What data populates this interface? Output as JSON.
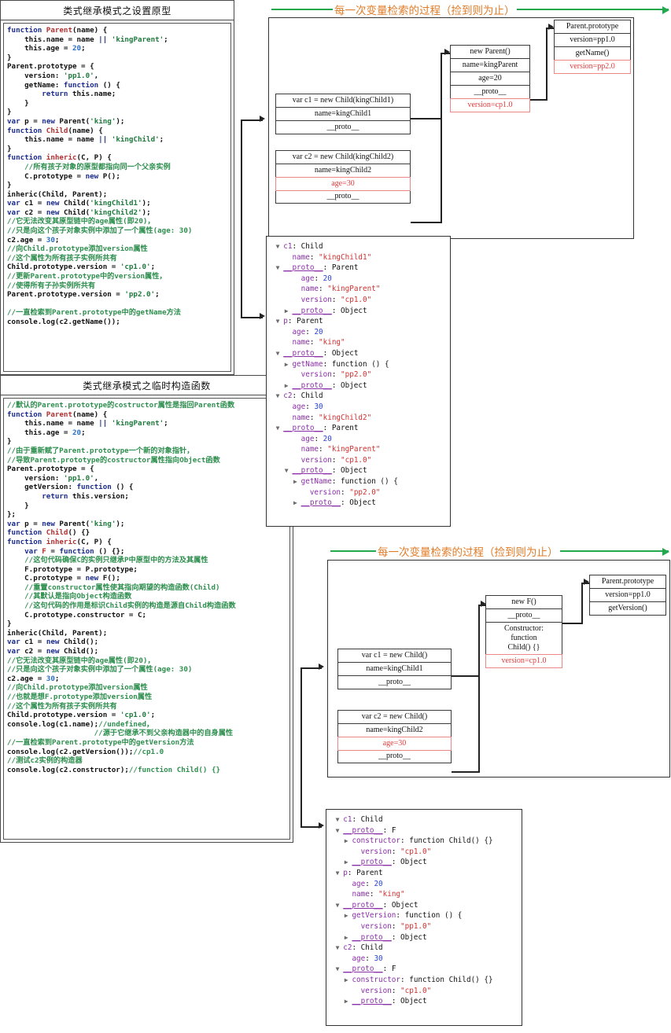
{
  "section1": {
    "code_title": "类式继承模式之设置原型",
    "banner": "每一次变量检索的过程（捡到则为止）",
    "code_lines": [
      [
        [
          "kw",
          "function "
        ],
        [
          "fn",
          "Parent"
        ],
        [
          "pl",
          "(name) {"
        ]
      ],
      [
        [
          "pl",
          "    this.name = name "
        ],
        [
          "kw",
          "|| "
        ],
        [
          "str",
          "'kingParent'"
        ],
        [
          "pl",
          ";"
        ]
      ],
      [
        [
          "pl",
          "    this.age = "
        ],
        [
          "num",
          "20"
        ],
        [
          "pl",
          ";"
        ]
      ],
      [
        [
          "pl",
          "}"
        ]
      ],
      [
        [
          "pl",
          "Parent.prototype = {"
        ]
      ],
      [
        [
          "pl",
          "    version: "
        ],
        [
          "str",
          "'pp1.0'"
        ],
        [
          "pl",
          ","
        ]
      ],
      [
        [
          "pl",
          "    getName: "
        ],
        [
          "kw",
          "function"
        ],
        [
          "pl",
          " () {"
        ]
      ],
      [
        [
          "kw",
          "        return "
        ],
        [
          "pl",
          "this.name;"
        ]
      ],
      [
        [
          "pl",
          "    }"
        ]
      ],
      [
        [
          "pl",
          "}"
        ]
      ],
      [
        [
          "kw",
          "var "
        ],
        [
          "pl",
          "p = "
        ],
        [
          "kw",
          "new "
        ],
        [
          "pl",
          "Parent("
        ],
        [
          "str",
          "'king'"
        ],
        [
          "pl",
          ");"
        ]
      ],
      [
        [
          "kw",
          "function "
        ],
        [
          "fn",
          "Child"
        ],
        [
          "pl",
          "(name) {"
        ]
      ],
      [
        [
          "pl",
          "    this.name = name "
        ],
        [
          "kw",
          "|| "
        ],
        [
          "str",
          "'kingChild'"
        ],
        [
          "pl",
          ";"
        ]
      ],
      [
        [
          "pl",
          "}"
        ]
      ],
      [
        [
          "kw",
          "function "
        ],
        [
          "fn",
          "inheric"
        ],
        [
          "pl",
          "(C, P) {"
        ]
      ],
      [
        [
          "cmt",
          "    //所有孩子对象的原型都指向同一个父亲实例"
        ]
      ],
      [
        [
          "pl",
          "    C.prototype = "
        ],
        [
          "kw",
          "new "
        ],
        [
          "pl",
          "P();"
        ]
      ],
      [
        [
          "pl",
          "}"
        ]
      ],
      [
        [
          "pl",
          "inheric(Child, Parent);"
        ]
      ],
      [
        [
          "kw",
          "var "
        ],
        [
          "pl",
          "c1 = "
        ],
        [
          "kw",
          "new "
        ],
        [
          "pl",
          "Child("
        ],
        [
          "str",
          "'kingChild1'"
        ],
        [
          "pl",
          ");"
        ]
      ],
      [
        [
          "kw",
          "var "
        ],
        [
          "pl",
          "c2 = "
        ],
        [
          "kw",
          "new "
        ],
        [
          "pl",
          "Child("
        ],
        [
          "str",
          "'kingChild2'"
        ],
        [
          "pl",
          ");"
        ]
      ],
      [
        [
          "cmt",
          "//它无法改变其原型链中的age属性(即20)，"
        ]
      ],
      [
        [
          "cmt",
          "//只是向这个孩子对象实例中添加了一个属性(age: 30)"
        ]
      ],
      [
        [
          "pl",
          "c2.age = "
        ],
        [
          "num",
          "30"
        ],
        [
          "pl",
          ";"
        ]
      ],
      [
        [
          "cmt",
          "//向Child.prototype添加version属性"
        ]
      ],
      [
        [
          "cmt",
          "//这个属性为所有孩子实例所共有"
        ]
      ],
      [
        [
          "pl",
          "Child.prototype.version = "
        ],
        [
          "str",
          "'cp1.0'"
        ],
        [
          "pl",
          ";"
        ]
      ],
      [
        [
          "cmt",
          "//更新Parent.prototype中的version属性，"
        ]
      ],
      [
        [
          "cmt",
          "//使得所有子孙实例所共有"
        ]
      ],
      [
        [
          "pl",
          "Parent.prototype.version = "
        ],
        [
          "str",
          "'pp2.0'"
        ],
        [
          "pl",
          ";"
        ]
      ],
      [
        [
          "pl",
          ""
        ]
      ],
      [
        [
          "cmt",
          "//一直检索到Parent.prototype中的getName方法"
        ]
      ],
      [
        [
          "pl",
          "console.log(c2.getName());"
        ]
      ]
    ],
    "boxes": {
      "c1": [
        "var c1 = new Child(kingChild1)",
        "name=kingChild1",
        "__proto__"
      ],
      "c2": [
        "var c2 = new Child(kingChild2)",
        "name=kingChild2",
        "age=30",
        "__proto__"
      ],
      "parent_inst": [
        "new Parent()",
        "name=kingParent",
        "age=20",
        "__proto__",
        "version=cp1.0"
      ],
      "parent_proto": [
        "Parent.prototype",
        "version=pp1.0",
        "getName()",
        "version=pp2.0"
      ]
    },
    "console_lines": [
      {
        "indent": 0,
        "tri": "▼",
        "key": "c1",
        "sep": ": ",
        "val": "Child",
        "vtype": "plain"
      },
      {
        "indent": 1,
        "tri": "",
        "key": "name",
        "sep": ": ",
        "val": "\"kingChild1\"",
        "vtype": "str"
      },
      {
        "indent": 0,
        "tri": "▼",
        "key": "__proto__",
        "sep": ": ",
        "val": "Parent",
        "vtype": "plain",
        "proto": true
      },
      {
        "indent": 2,
        "tri": "",
        "key": "age",
        "sep": ": ",
        "val": "20",
        "vtype": "num"
      },
      {
        "indent": 2,
        "tri": "",
        "key": "name",
        "sep": ": ",
        "val": "\"kingParent\"",
        "vtype": "str"
      },
      {
        "indent": 2,
        "tri": "",
        "key": "version",
        "sep": ": ",
        "val": "\"cp1.0\"",
        "vtype": "str"
      },
      {
        "indent": 1,
        "tri": "▶",
        "key": "__proto__",
        "sep": ": ",
        "val": "Object",
        "vtype": "plain",
        "proto": true
      },
      {
        "indent": 0,
        "tri": "▼",
        "key": "p",
        "sep": ": ",
        "val": "Parent",
        "vtype": "plain"
      },
      {
        "indent": 1,
        "tri": "",
        "key": "age",
        "sep": ": ",
        "val": "20",
        "vtype": "num"
      },
      {
        "indent": 1,
        "tri": "",
        "key": "name",
        "sep": ": ",
        "val": "\"king\"",
        "vtype": "str"
      },
      {
        "indent": 0,
        "tri": "▼",
        "key": "__proto__",
        "sep": ": ",
        "val": "Object",
        "vtype": "plain",
        "proto": true
      },
      {
        "indent": 1,
        "tri": "▶",
        "key": "getName",
        "sep": ": ",
        "val": "function () {",
        "vtype": "plain"
      },
      {
        "indent": 2,
        "tri": "",
        "key": "version",
        "sep": ": ",
        "val": "\"pp2.0\"",
        "vtype": "str"
      },
      {
        "indent": 1,
        "tri": "▶",
        "key": "__proto__",
        "sep": ": ",
        "val": "Object",
        "vtype": "plain",
        "proto": true
      },
      {
        "indent": 0,
        "tri": "▼",
        "key": "c2",
        "sep": ": ",
        "val": "Child",
        "vtype": "plain"
      },
      {
        "indent": 1,
        "tri": "",
        "key": "age",
        "sep": ": ",
        "val": "30",
        "vtype": "num"
      },
      {
        "indent": 1,
        "tri": "",
        "key": "name",
        "sep": ": ",
        "val": "\"kingChild2\"",
        "vtype": "str"
      },
      {
        "indent": 0,
        "tri": "▼",
        "key": "__proto__",
        "sep": ": ",
        "val": "Parent",
        "vtype": "plain",
        "proto": true
      },
      {
        "indent": 2,
        "tri": "",
        "key": "age",
        "sep": ": ",
        "val": "20",
        "vtype": "num"
      },
      {
        "indent": 2,
        "tri": "",
        "key": "name",
        "sep": ": ",
        "val": "\"kingParent\"",
        "vtype": "str"
      },
      {
        "indent": 2,
        "tri": "",
        "key": "version",
        "sep": ": ",
        "val": "\"cp1.0\"",
        "vtype": "str"
      },
      {
        "indent": 1,
        "tri": "▼",
        "key": "__proto__",
        "sep": ": ",
        "val": "Object",
        "vtype": "plain",
        "proto": true
      },
      {
        "indent": 2,
        "tri": "▶",
        "key": "getName",
        "sep": ": ",
        "val": "function () {",
        "vtype": "plain"
      },
      {
        "indent": 3,
        "tri": "",
        "key": "version",
        "sep": ": ",
        "val": "\"pp2.0\"",
        "vtype": "str"
      },
      {
        "indent": 2,
        "tri": "▶",
        "key": "__proto__",
        "sep": ": ",
        "val": "Object",
        "vtype": "plain",
        "proto": true
      }
    ]
  },
  "section2": {
    "code_title": "类式继承模式之临时构造函数",
    "banner": "每一次变量检索的过程（捡到则为止）",
    "code_lines": [
      [
        [
          "cmt",
          "//默认的Parent.prototype的costructor属性是指回Parent函数"
        ]
      ],
      [
        [
          "kw",
          "function "
        ],
        [
          "fn",
          "Parent"
        ],
        [
          "pl",
          "(name) {"
        ]
      ],
      [
        [
          "pl",
          "    this.name = name "
        ],
        [
          "kw",
          "|| "
        ],
        [
          "str",
          "'kingParent'"
        ],
        [
          "pl",
          ";"
        ]
      ],
      [
        [
          "pl",
          "    this.age = "
        ],
        [
          "num",
          "20"
        ],
        [
          "pl",
          ";"
        ]
      ],
      [
        [
          "pl",
          "}"
        ]
      ],
      [
        [
          "cmt",
          "//由于重新赋了Parent.prototype一个新的对象指针，"
        ]
      ],
      [
        [
          "cmt",
          "//导致Parent.prototype的costructor属性指向Object函数"
        ]
      ],
      [
        [
          "pl",
          "Parent.prototype = {"
        ]
      ],
      [
        [
          "pl",
          "    version: "
        ],
        [
          "str",
          "'pp1.0'"
        ],
        [
          "pl",
          ","
        ]
      ],
      [
        [
          "pl",
          "    getVersion: "
        ],
        [
          "kw",
          "function"
        ],
        [
          "pl",
          " () {"
        ]
      ],
      [
        [
          "kw",
          "        return "
        ],
        [
          "pl",
          "this.version;"
        ]
      ],
      [
        [
          "pl",
          "    }"
        ]
      ],
      [
        [
          "pl",
          "};"
        ]
      ],
      [
        [
          "kw",
          "var "
        ],
        [
          "pl",
          "p = "
        ],
        [
          "kw",
          "new "
        ],
        [
          "pl",
          "Parent("
        ],
        [
          "str",
          "'king'"
        ],
        [
          "pl",
          ");"
        ]
      ],
      [
        [
          "kw",
          "function "
        ],
        [
          "fn",
          "Child"
        ],
        [
          "pl",
          "() {}"
        ]
      ],
      [
        [
          "kw",
          "function "
        ],
        [
          "fn",
          "inheric"
        ],
        [
          "pl",
          "(C, P) {"
        ]
      ],
      [
        [
          "pl",
          "    "
        ],
        [
          "kw",
          "var "
        ],
        [
          "fn",
          "F"
        ],
        [
          "pl",
          " = "
        ],
        [
          "kw",
          "function"
        ],
        [
          "pl",
          " () {};"
        ]
      ],
      [
        [
          "cmt",
          "    //这句代码确保C的实例只继承P中原型中的方法及其属性"
        ]
      ],
      [
        [
          "pl",
          "    F.prototype = P.prototype;"
        ]
      ],
      [
        [
          "pl",
          "    C.prototype = "
        ],
        [
          "kw",
          "new "
        ],
        [
          "pl",
          "F();"
        ]
      ],
      [
        [
          "cmt",
          "    //重置constructor属性使其指向期望的构造函数(Child)"
        ]
      ],
      [
        [
          "cmt",
          "    //其默认是指向Object构造函数"
        ]
      ],
      [
        [
          "cmt",
          "    //这句代码的作用是标识Child实例的构造是源自Child构造函数"
        ]
      ],
      [
        [
          "pl",
          "    C.prototype.constructor = C;"
        ]
      ],
      [
        [
          "pl",
          "}"
        ]
      ],
      [
        [
          "pl",
          "inheric(Child, Parent);"
        ]
      ],
      [
        [
          "kw",
          "var "
        ],
        [
          "pl",
          "c1 = "
        ],
        [
          "kw",
          "new "
        ],
        [
          "pl",
          "Child();"
        ]
      ],
      [
        [
          "kw",
          "var "
        ],
        [
          "pl",
          "c2 = "
        ],
        [
          "kw",
          "new "
        ],
        [
          "pl",
          "Child();"
        ]
      ],
      [
        [
          "cmt",
          "//它无法改变其原型链中的age属性(即20)，"
        ]
      ],
      [
        [
          "cmt",
          "//只是向这个孩子对象实例中添加了一个属性(age: 30)"
        ]
      ],
      [
        [
          "pl",
          "c2.age = "
        ],
        [
          "num",
          "30"
        ],
        [
          "pl",
          ";"
        ]
      ],
      [
        [
          "cmt",
          "//向Child.prototype添加version属性"
        ]
      ],
      [
        [
          "cmt",
          "//也就是想F.prototype添加version属性"
        ]
      ],
      [
        [
          "cmt",
          "//这个属性为所有孩子实例所共有"
        ]
      ],
      [
        [
          "pl",
          "Child.prototype.version = "
        ],
        [
          "str",
          "'cp1.0'"
        ],
        [
          "pl",
          ";"
        ]
      ],
      [
        [
          "pl",
          "console.log(c1.name);"
        ],
        [
          "cmt",
          "//undefined，"
        ]
      ],
      [
        [
          "cmt",
          "                    //源于它继承不到父亲构造器中的自身属性"
        ]
      ],
      [
        [
          "cmt",
          "//一直检索到Parent.prototype中的getVersion方法"
        ]
      ],
      [
        [
          "pl",
          "console.log(c2.getVersion());"
        ],
        [
          "cmt",
          "//cp1.0"
        ]
      ],
      [
        [
          "cmt",
          "//测试c2实例的构造器"
        ]
      ],
      [
        [
          "pl",
          "console.log(c2.constructor);"
        ],
        [
          "cmt",
          "//function Child() {}"
        ]
      ]
    ],
    "boxes": {
      "c1": [
        "var c1 = new Child()",
        "name=kingChild1",
        "__proto__"
      ],
      "c2": [
        "var c2 = new Child()",
        "name=kingChild2",
        "age=30",
        "__proto__"
      ],
      "f_inst": [
        "new F()",
        "__proto__",
        "Constructor:\nfunction\nChild() {}",
        "version=cp1.0"
      ],
      "parent_proto": [
        "Parent.prototype",
        "version=pp1.0",
        "getVersion()"
      ]
    },
    "console_lines": [
      {
        "indent": 0,
        "tri": "▼",
        "key": "c1",
        "sep": ": ",
        "val": "Child",
        "vtype": "plain"
      },
      {
        "indent": 0,
        "tri": "▼",
        "key": "__proto__",
        "sep": ": ",
        "val": "F",
        "vtype": "plain",
        "proto": true
      },
      {
        "indent": 1,
        "tri": "▶",
        "key": "constructor",
        "sep": ": ",
        "val": "function Child() {}",
        "vtype": "plain"
      },
      {
        "indent": 2,
        "tri": "",
        "key": "version",
        "sep": ": ",
        "val": "\"cp1.0\"",
        "vtype": "str"
      },
      {
        "indent": 1,
        "tri": "▶",
        "key": "__proto__",
        "sep": ": ",
        "val": "Object",
        "vtype": "plain",
        "proto": true
      },
      {
        "indent": 0,
        "tri": "▼",
        "key": "p",
        "sep": ": ",
        "val": "Parent",
        "vtype": "plain"
      },
      {
        "indent": 1,
        "tri": "",
        "key": "age",
        "sep": ": ",
        "val": "20",
        "vtype": "num"
      },
      {
        "indent": 1,
        "tri": "",
        "key": "name",
        "sep": ": ",
        "val": "\"king\"",
        "vtype": "str"
      },
      {
        "indent": 0,
        "tri": "▼",
        "key": "__proto__",
        "sep": ": ",
        "val": "Object",
        "vtype": "plain",
        "proto": true
      },
      {
        "indent": 1,
        "tri": "▶",
        "key": "getVersion",
        "sep": ": ",
        "val": "function () {",
        "vtype": "plain"
      },
      {
        "indent": 2,
        "tri": "",
        "key": "version",
        "sep": ": ",
        "val": "\"pp1.0\"",
        "vtype": "str"
      },
      {
        "indent": 1,
        "tri": "▶",
        "key": "__proto__",
        "sep": ": ",
        "val": "Object",
        "vtype": "plain",
        "proto": true
      },
      {
        "indent": 0,
        "tri": "▼",
        "key": "c2",
        "sep": ": ",
        "val": "Child",
        "vtype": "plain"
      },
      {
        "indent": 1,
        "tri": "",
        "key": "age",
        "sep": ": ",
        "val": "30",
        "vtype": "num"
      },
      {
        "indent": 0,
        "tri": "▼",
        "key": "__proto__",
        "sep": ": ",
        "val": "F",
        "vtype": "plain",
        "proto": true
      },
      {
        "indent": 1,
        "tri": "▶",
        "key": "constructor",
        "sep": ": ",
        "val": "function Child() {}",
        "vtype": "plain"
      },
      {
        "indent": 2,
        "tri": "",
        "key": "version",
        "sep": ": ",
        "val": "\"cp1.0\"",
        "vtype": "str"
      },
      {
        "indent": 1,
        "tri": "▶",
        "key": "__proto__",
        "sep": ": ",
        "val": "Object",
        "vtype": "plain",
        "proto": true
      }
    ]
  },
  "colors": {
    "banner_text": "#e07b26",
    "banner_line": "#24a84e",
    "red_highlight": "#e23b3b",
    "comment": "#2f8f4f",
    "keyword": "#1b2b8f",
    "string": "#1f7a3d",
    "console_key": "#8b2fa8",
    "console_string": "#d0302f",
    "console_number": "#2a42d6"
  }
}
